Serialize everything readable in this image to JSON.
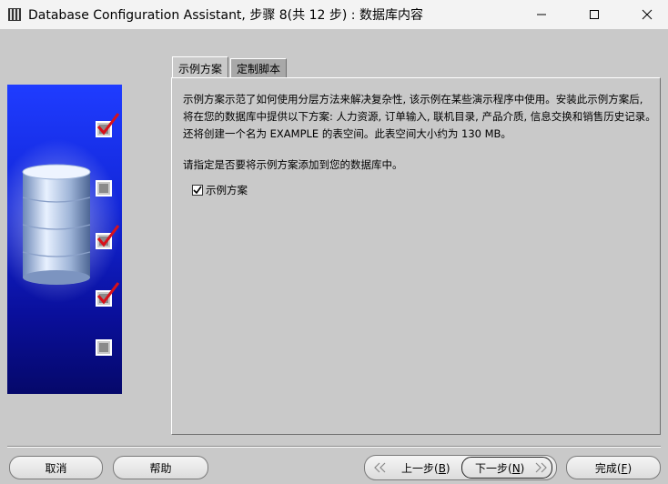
{
  "window": {
    "title": "Database Configuration Assistant, 步骤 8(共 12 步) : 数据库内容",
    "min_icon": "minimize-icon",
    "max_icon": "maximize-icon",
    "close_icon": "close-icon"
  },
  "tabs": [
    {
      "label": "示例方案",
      "active": true
    },
    {
      "label": "定制脚本",
      "active": false
    }
  ],
  "content": {
    "description": "示例方案示范了如何使用分层方法来解决复杂性, 该示例在某些演示程序中使用。安装此示例方案后, 将在您的数据库中提供以下方案: 人力资源, 订单输入, 联机目录, 产品介质, 信息交换和销售历史记录。还将创建一个名为 EXAMPLE 的表空间。此表空间大小约为 130 MB。",
    "prompt": "请指定是否要将示例方案添加到您的数据库中。",
    "checkbox_label": "示例方案",
    "checkbox_checked": true
  },
  "buttons": {
    "cancel": "取消",
    "help": "帮助",
    "back_prefix": "上一步(",
    "back_key": "B",
    "back_suffix": ")",
    "next_prefix": "下一步(",
    "next_key": "N",
    "next_suffix": ")",
    "finish_prefix": "完成(",
    "finish_key": "F",
    "finish_suffix": ")"
  },
  "colors": {
    "accent_check": "#d8101a",
    "panel_bg": "#c9c9c9",
    "side_blue": "#1226d8"
  }
}
